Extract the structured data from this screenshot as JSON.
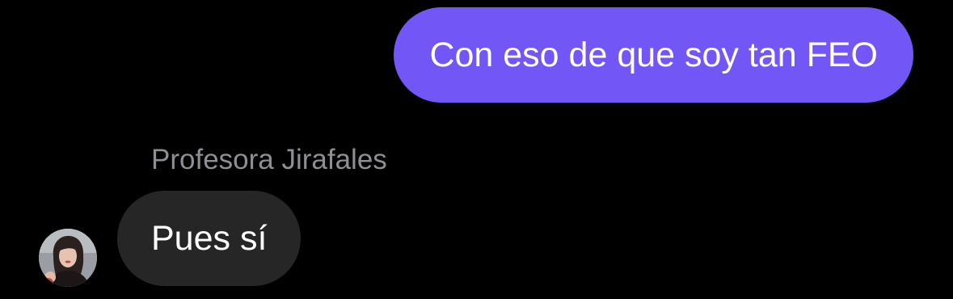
{
  "conversation": {
    "messages": [
      {
        "direction": "outgoing",
        "text": "Con eso de que soy tan FEO"
      },
      {
        "direction": "incoming",
        "sender": "Profesora Jirafales",
        "text": "Pues sí"
      }
    ]
  },
  "colors": {
    "background": "#000000",
    "outgoing_bubble": "#7357f6",
    "incoming_bubble": "#262626",
    "sender_name": "#8e8e93"
  },
  "icons": {
    "avatar": "profile-photo-avatar"
  }
}
